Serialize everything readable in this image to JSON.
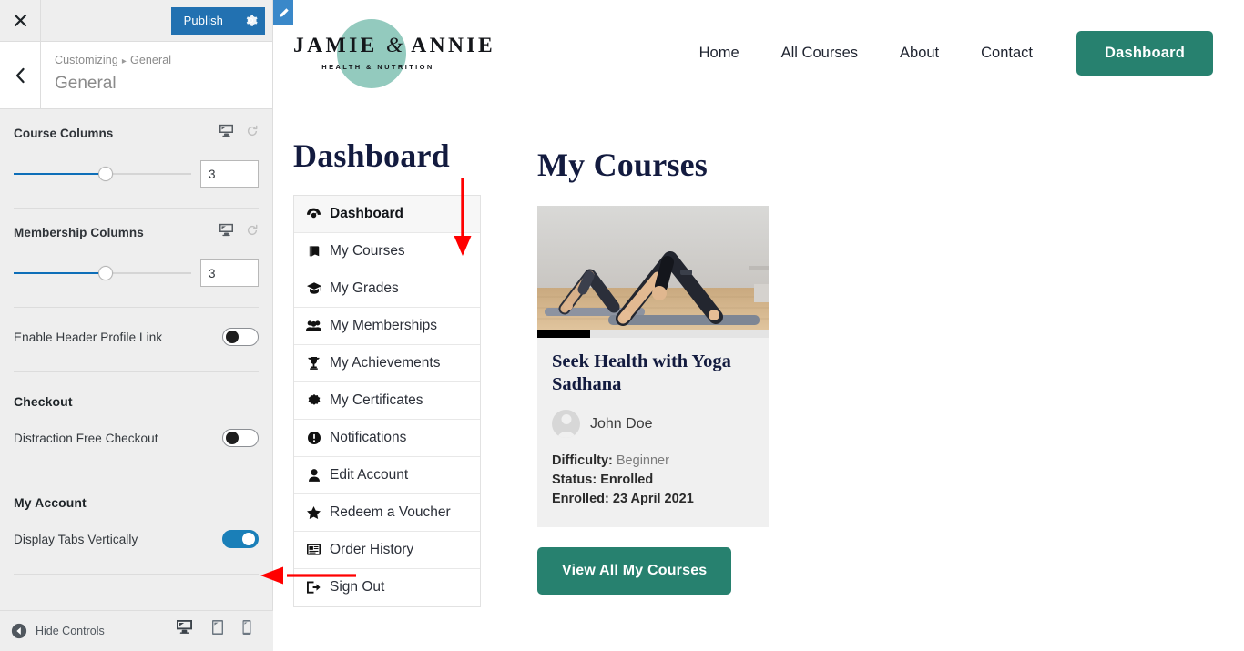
{
  "customizer": {
    "close_label": "×",
    "publish_label": "Publish",
    "gear_icon": "gear-icon",
    "back_icon": "chevron-left-icon",
    "breadcrumb_root": "Customizing",
    "breadcrumb_sep": "▸",
    "breadcrumb_current": "General",
    "section_title": "General",
    "edit_pencil_icon": "pencil-icon",
    "controls": [
      {
        "id": "course-columns",
        "label": "Course Columns",
        "type": "slider",
        "value": "3",
        "fill_percent": 52,
        "device_icon": "desktop-icon",
        "reset_icon": "reset-icon"
      },
      {
        "id": "membership-columns",
        "label": "Membership Columns",
        "type": "slider",
        "value": "3",
        "fill_percent": 52,
        "device_icon": "desktop-icon",
        "reset_icon": "reset-icon"
      },
      {
        "id": "enable-header-profile-link",
        "label": "Enable Header Profile Link",
        "type": "toggle",
        "on": false
      },
      {
        "id": "checkout-heading",
        "label": "Checkout",
        "type": "heading"
      },
      {
        "id": "distraction-free-checkout",
        "label": "Distraction Free Checkout",
        "type": "toggle",
        "on": false
      },
      {
        "id": "my-account-heading",
        "label": "My Account",
        "type": "heading"
      },
      {
        "id": "display-tabs-vertically",
        "label": "Display Tabs Vertically",
        "type": "toggle",
        "on": true
      }
    ],
    "footer": {
      "hide_controls_label": "Hide Controls",
      "hide_controls_icon": "collapse-left-icon",
      "devices": [
        {
          "name": "desktop-icon",
          "active": true
        },
        {
          "name": "tablet-icon",
          "active": false
        },
        {
          "name": "mobile-icon",
          "active": false
        }
      ]
    }
  },
  "preview": {
    "logo": {
      "brand_left": "JAMIE",
      "brand_amp": "&",
      "brand_right": "ANNIE",
      "tagline": "HEALTH & NUTRITION",
      "circle_color": "#93cabe"
    },
    "nav": {
      "links": [
        "Home",
        "All Courses",
        "About",
        "Contact"
      ],
      "cta_label": "Dashboard",
      "cta_color": "#27816f"
    },
    "dashboard": {
      "title": "Dashboard",
      "tabs": [
        {
          "label": "Dashboard",
          "icon": "dashboard-icon",
          "active": true
        },
        {
          "label": "My Courses",
          "icon": "book-icon",
          "active": false
        },
        {
          "label": "My Grades",
          "icon": "graduation-cap-icon",
          "active": false
        },
        {
          "label": "My Memberships",
          "icon": "users-icon",
          "active": false
        },
        {
          "label": "My Achievements",
          "icon": "trophy-icon",
          "active": false
        },
        {
          "label": "My Certificates",
          "icon": "certificate-icon",
          "active": false
        },
        {
          "label": "Notifications",
          "icon": "exclamation-circle-icon",
          "active": false
        },
        {
          "label": "Edit Account",
          "icon": "user-icon",
          "active": false
        },
        {
          "label": "Redeem a Voucher",
          "icon": "star-icon",
          "active": false
        },
        {
          "label": "Order History",
          "icon": "list-alt-icon",
          "active": false
        },
        {
          "label": "Sign Out",
          "icon": "sign-out-icon",
          "active": false
        }
      ]
    },
    "courses": {
      "title": "My Courses",
      "card": {
        "progress_percent": 23,
        "title": "Seek Health with Yoga Sadhana",
        "author": "John Doe",
        "difficulty_key": "Difficulty:",
        "difficulty_value": "Beginner",
        "status_key": "Status:",
        "status_value": "Enrolled",
        "enrolled_key": "Enrolled:",
        "enrolled_value": "23 April 2021"
      },
      "view_all_label": "View All My Courses"
    }
  },
  "annotations": {
    "arrow_color": "#ff0000",
    "arrow_down_name": "annotation-arrow-down",
    "arrow_left_name": "annotation-arrow-left"
  }
}
